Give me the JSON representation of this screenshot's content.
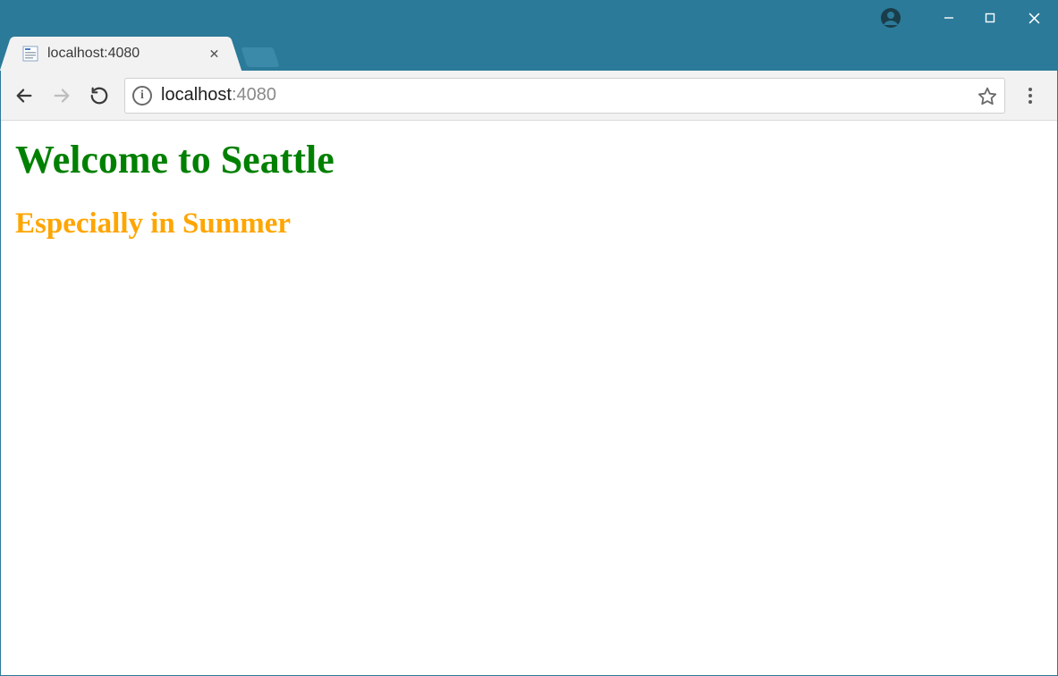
{
  "window": {
    "controls": {
      "minimize": "—",
      "maximize": "▢",
      "close": "✕"
    }
  },
  "tab": {
    "title": "localhost:4080",
    "close": "✕"
  },
  "address": {
    "host": "localhost",
    "port": ":4080",
    "info": "i"
  },
  "page": {
    "h1": "Welcome to Seattle",
    "h2": "Especially in Summer"
  }
}
